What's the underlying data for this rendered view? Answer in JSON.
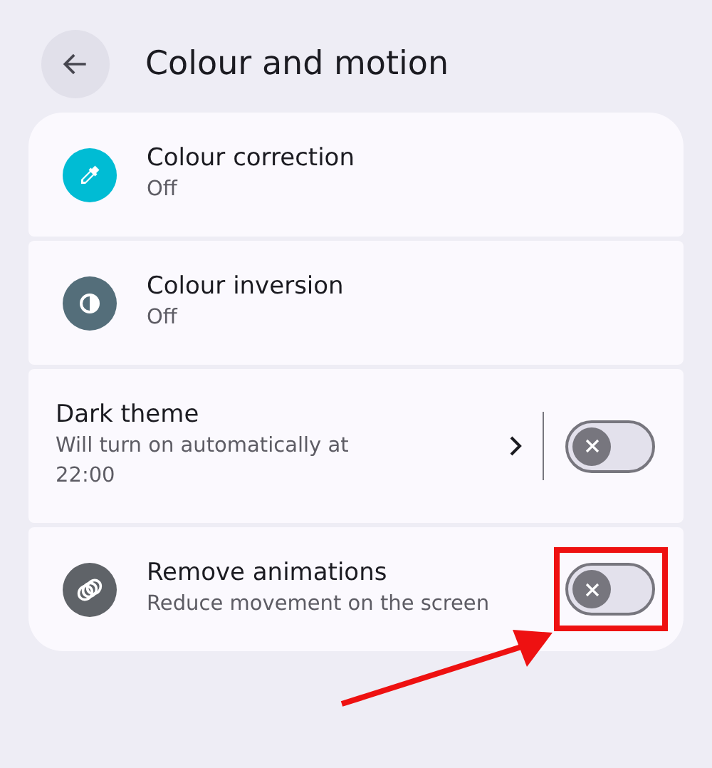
{
  "header": {
    "title": "Colour and motion"
  },
  "items": [
    {
      "kind": "link",
      "title": "Colour correction",
      "subtitle": "Off",
      "color": "#00bcd4"
    },
    {
      "kind": "link",
      "title": "Colour inversion",
      "subtitle": "Off",
      "color": "#546e7a"
    },
    {
      "kind": "split_toggle",
      "title": "Dark theme",
      "subtitle": "Will turn on automatically at 22:00",
      "on": false,
      "highlighted": false
    },
    {
      "kind": "toggle",
      "title": "Remove animations",
      "subtitle": "Reduce movement on the screen",
      "color": "#5f6368",
      "on": false,
      "highlighted": true
    }
  ]
}
